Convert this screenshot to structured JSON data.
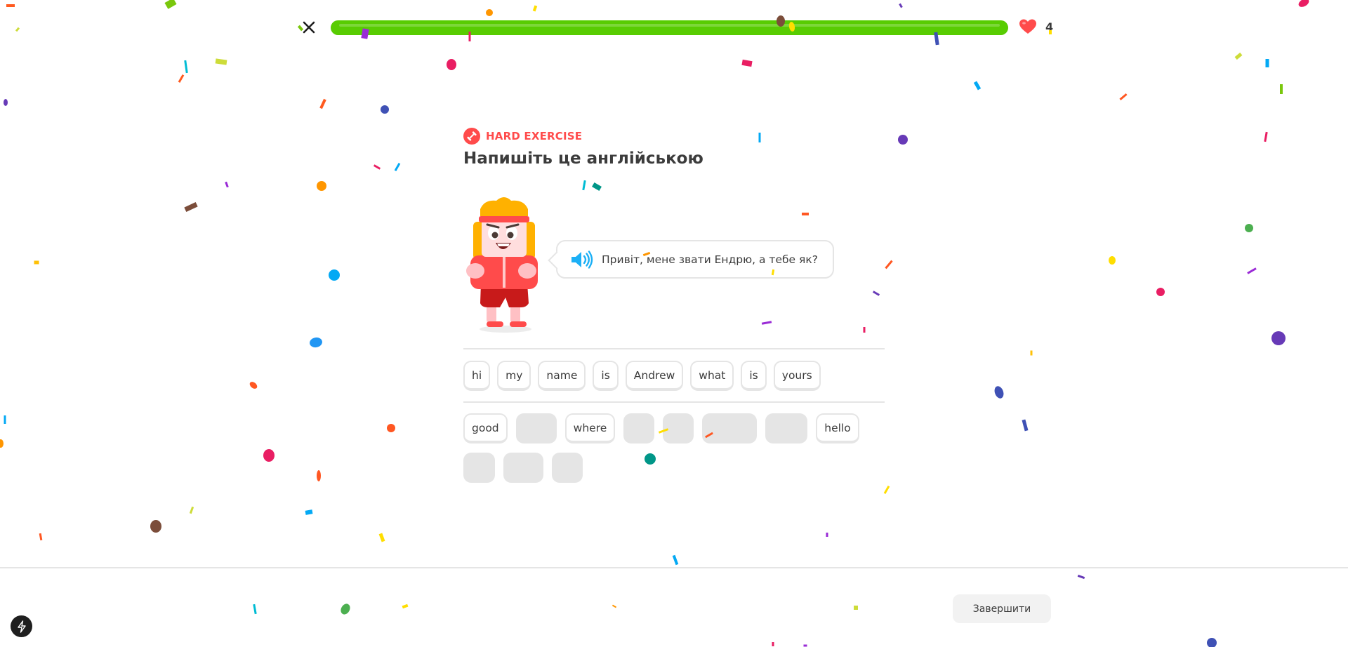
{
  "header": {
    "close_icon": "close-icon",
    "progress_fraction": 1.0,
    "progress_color": "#58cc02",
    "hearts_icon": "heart-icon",
    "hearts_count": "4"
  },
  "challenge": {
    "label": "HARD EXERCISE",
    "label_color": "#ff4b4b",
    "prompt": "Напишіть це англійською",
    "sentence": "Привіт, мене звати Ендрю, а тебе як?",
    "speaker_icon": "speaker-icon",
    "answer_tiles": [
      "hi",
      "my",
      "name",
      "is",
      "Andrew",
      "what",
      "is",
      "yours"
    ],
    "word_bank": [
      {
        "word": "good",
        "used": false
      },
      {
        "word": "",
        "used": true
      },
      {
        "word": "where",
        "used": false
      },
      {
        "word": "",
        "used": true
      },
      {
        "word": "",
        "used": true
      },
      {
        "word": "",
        "used": true
      },
      {
        "word": "",
        "used": true
      },
      {
        "word": "hello",
        "used": false
      },
      {
        "word": "",
        "used": true
      },
      {
        "word": "",
        "used": true
      },
      {
        "word": "",
        "used": true
      }
    ]
  },
  "footer": {
    "finish_label": "Завершити",
    "bolt_icon": "lightning-icon"
  }
}
